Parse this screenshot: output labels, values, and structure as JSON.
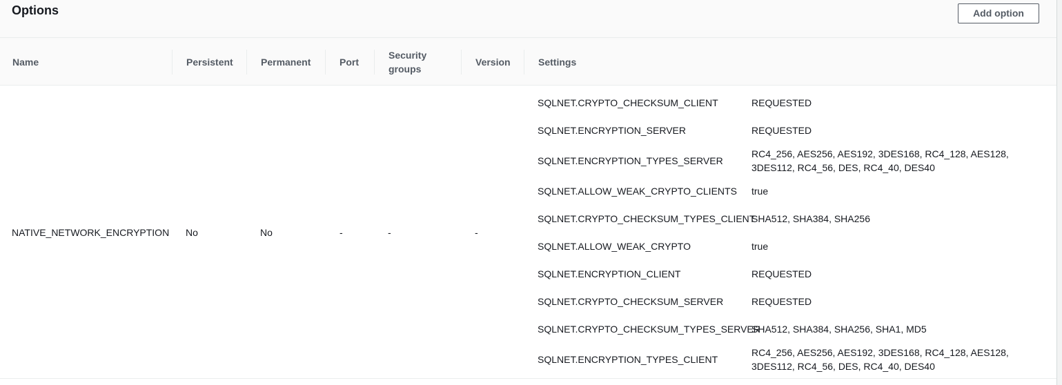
{
  "panel": {
    "title": "Options",
    "add_button_label": "Add option"
  },
  "columns": {
    "name": "Name",
    "persistent": "Persistent",
    "permanent": "Permanent",
    "port": "Port",
    "security_groups_line1": "Security",
    "security_groups_line2": "groups",
    "version": "Version",
    "settings": "Settings"
  },
  "row": {
    "name": "NATIVE_NETWORK_ENCRYPTION",
    "persistent": "No",
    "permanent": "No",
    "port": "-",
    "security_groups": "-",
    "version": "-",
    "settings": [
      {
        "name": "SQLNET.CRYPTO_CHECKSUM_CLIENT",
        "value": "REQUESTED"
      },
      {
        "name": "SQLNET.ENCRYPTION_SERVER",
        "value": "REQUESTED"
      },
      {
        "name": "SQLNET.ENCRYPTION_TYPES_SERVER",
        "value": "RC4_256, AES256, AES192, 3DES168, RC4_128, AES128, 3DES112, RC4_56, DES, RC4_40, DES40"
      },
      {
        "name": "SQLNET.ALLOW_WEAK_CRYPTO_CLIENTS",
        "value": "true"
      },
      {
        "name": "SQLNET.CRYPTO_CHECKSUM_TYPES_CLIENT",
        "value": "SHA512, SHA384, SHA256"
      },
      {
        "name": "SQLNET.ALLOW_WEAK_CRYPTO",
        "value": "true"
      },
      {
        "name": "SQLNET.ENCRYPTION_CLIENT",
        "value": "REQUESTED"
      },
      {
        "name": "SQLNET.CRYPTO_CHECKSUM_SERVER",
        "value": "REQUESTED"
      },
      {
        "name": "SQLNET.CRYPTO_CHECKSUM_TYPES_SERVER",
        "value": "SHA512, SHA384, SHA256, SHA1, MD5"
      },
      {
        "name": "SQLNET.ENCRYPTION_TYPES_CLIENT",
        "value": "RC4_256, AES256, AES192, 3DES168, RC4_128, AES128, 3DES112, RC4_56, DES, RC4_40, DES40"
      }
    ]
  }
}
